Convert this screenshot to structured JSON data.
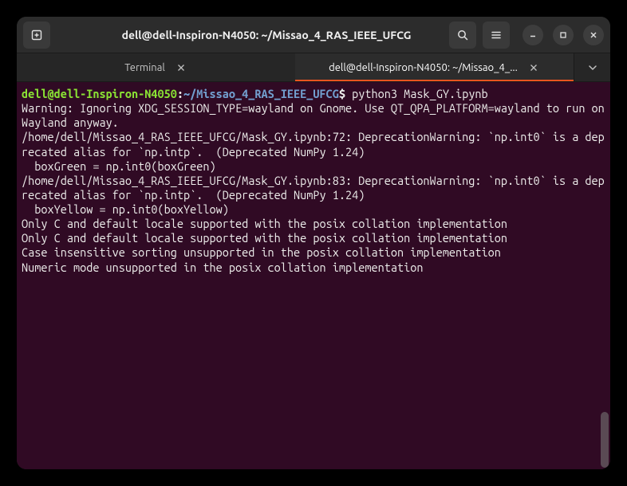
{
  "window": {
    "title": "dell@dell-Inspiron-N4050: ~/Missao_4_RAS_IEEE_UFCG"
  },
  "tabs": [
    {
      "label": "Terminal",
      "active": false
    },
    {
      "label": "dell@dell-Inspiron-N4050: ~/Missao_4_...",
      "active": true
    }
  ],
  "prompt": {
    "user_host": "dell@dell-Inspiron-N4050",
    "separator": ":",
    "path": "~/Missao_4_RAS_IEEE_UFCG",
    "symbol": "$"
  },
  "command": "python3 Mask_GY.ipynb",
  "output_lines": [
    "Warning: Ignoring XDG_SESSION_TYPE=wayland on Gnome. Use QT_QPA_PLATFORM=wayland to run on Wayland anyway.",
    "/home/dell/Missao_4_RAS_IEEE_UFCG/Mask_GY.ipynb:72: DeprecationWarning: `np.int0` is a deprecated alias for `np.intp`.  (Deprecated NumPy 1.24)",
    "  boxGreen = np.int0(boxGreen)",
    "/home/dell/Missao_4_RAS_IEEE_UFCG/Mask_GY.ipynb:83: DeprecationWarning: `np.int0` is a deprecated alias for `np.intp`.  (Deprecated NumPy 1.24)",
    "  boxYellow = np.int0(boxYellow)",
    "Only C and default locale supported with the posix collation implementation",
    "Only C and default locale supported with the posix collation implementation",
    "Case insensitive sorting unsupported in the posix collation implementation",
    "Numeric mode unsupported in the posix collation implementation"
  ]
}
